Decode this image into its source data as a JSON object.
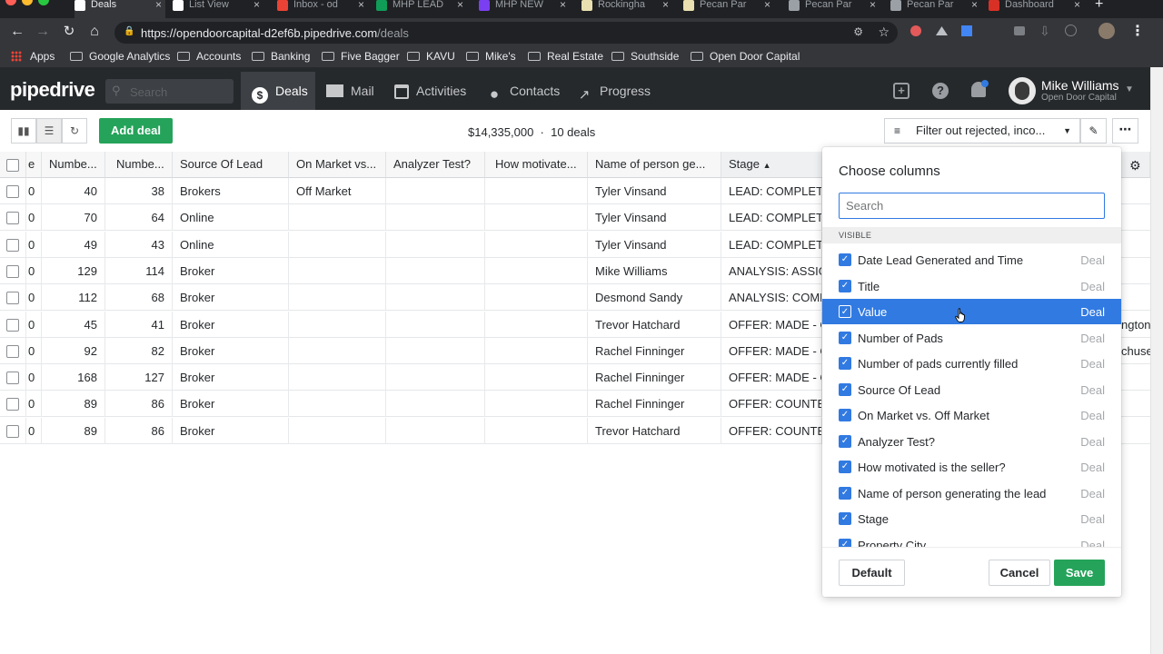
{
  "browser": {
    "tabs": [
      {
        "label": "Deals",
        "color": "#ffffff"
      },
      {
        "label": "List View",
        "color": "#ffffff"
      },
      {
        "label": "Inbox - od",
        "color": "#ea4335"
      },
      {
        "label": "MHP LEAD",
        "color": "#0f9d58"
      },
      {
        "label": "MHP NEW",
        "color": "#7b3ff2"
      },
      {
        "label": "Rockingha",
        "color": "#e9dfb0"
      },
      {
        "label": "Pecan Par",
        "color": "#e9dfb0"
      },
      {
        "label": "Pecan Par",
        "color": "#9aa0a6"
      },
      {
        "label": "Pecan Par",
        "color": "#9aa0a6"
      },
      {
        "label": "Dashboard",
        "color": "#d93025"
      }
    ],
    "url_host": "https://opendoorcapital-d2ef6b.pipedrive.com",
    "url_path": "/deals",
    "bookmarks": [
      "Apps",
      "Google Analytics",
      "Accounts",
      "Banking",
      "Five Bagger",
      "KAVU",
      "Mike's",
      "Real Estate",
      "Southside",
      "Open Door Capital"
    ]
  },
  "header": {
    "logo": "pipedrive",
    "search_placeholder": "Search",
    "nav": [
      "Deals",
      "Mail",
      "Activities",
      "Contacts",
      "Progress"
    ],
    "user_name": "Mike Williams",
    "user_org": "Open Door Capital"
  },
  "toolbar": {
    "add_deal": "Add deal",
    "total": "$14,335,000",
    "separator": "·",
    "count": "10 deals",
    "filter": "Filter out rejected, inco..."
  },
  "table": {
    "headers": [
      "e",
      "Numbe...",
      "Numbe...",
      "Source Of Lead",
      "On Market vs...",
      "Analyzer Test?",
      "How motivate...",
      "Name of person ge...",
      "Stage"
    ],
    "rows": [
      {
        "a": "0",
        "n1": "40",
        "n2": "38",
        "source": "Brokers",
        "market": "Off Market",
        "person": "Tyler Vinsand",
        "stage": "LEAD: COMPLETE-",
        "extra": ""
      },
      {
        "a": "0",
        "n1": "70",
        "n2": "64",
        "source": "Online",
        "market": "",
        "person": "Tyler Vinsand",
        "stage": "LEAD: COMPLETE-",
        "extra": ""
      },
      {
        "a": "0",
        "n1": "49",
        "n2": "43",
        "source": "Online",
        "market": "",
        "person": "Tyler Vinsand",
        "stage": "LEAD: COMPLETE-",
        "extra": ""
      },
      {
        "a": "0",
        "n1": "129",
        "n2": "114",
        "source": "Broker",
        "market": "",
        "person": "Mike Williams",
        "stage": "ANALYSIS: ASSIGN",
        "extra": ""
      },
      {
        "a": "0",
        "n1": "112",
        "n2": "68",
        "source": "Broker",
        "market": "",
        "person": "Desmond Sandy",
        "stage": "ANALYSIS: COMPL",
        "extra": ""
      },
      {
        "a": "0",
        "n1": "45",
        "n2": "41",
        "source": "Broker",
        "market": "",
        "person": "Trevor Hatchard",
        "stage": "OFFER: MADE - Co",
        "extra": "ngton"
      },
      {
        "a": "0",
        "n1": "92",
        "n2": "82",
        "source": "Broker",
        "market": "",
        "person": "Rachel Finninger",
        "stage": "OFFER: MADE - Co",
        "extra": "chuset"
      },
      {
        "a": "0",
        "n1": "168",
        "n2": "127",
        "source": "Broker",
        "market": "",
        "person": "Rachel Finninger",
        "stage": "OFFER: MADE - Co",
        "extra": ""
      },
      {
        "a": "0",
        "n1": "89",
        "n2": "86",
        "source": "Broker",
        "market": "",
        "person": "Rachel Finninger",
        "stage": "OFFER: COUNTER",
        "extra": ""
      },
      {
        "a": "0",
        "n1": "89",
        "n2": "86",
        "source": "Broker",
        "market": "",
        "person": "Trevor Hatchard",
        "stage": "OFFER: COUNTER",
        "extra": ""
      }
    ]
  },
  "modal": {
    "title": "Choose columns",
    "search_placeholder": "Search",
    "section": "VISIBLE",
    "columns": [
      {
        "name": "Date Lead Generated and Time",
        "type": "Deal",
        "checked": true
      },
      {
        "name": "Title",
        "type": "Deal",
        "checked": true
      },
      {
        "name": "Value",
        "type": "Deal",
        "checked": true,
        "highlighted": true
      },
      {
        "name": "Number of Pads",
        "type": "Deal",
        "checked": true
      },
      {
        "name": "Number of pads currently filled",
        "type": "Deal",
        "checked": true
      },
      {
        "name": "Source Of Lead",
        "type": "Deal",
        "checked": true
      },
      {
        "name": "On Market vs. Off Market",
        "type": "Deal",
        "checked": true
      },
      {
        "name": "Analyzer Test?",
        "type": "Deal",
        "checked": true
      },
      {
        "name": "How motivated is the seller?",
        "type": "Deal",
        "checked": true
      },
      {
        "name": "Name of person generating the lead",
        "type": "Deal",
        "checked": true
      },
      {
        "name": "Stage",
        "type": "Deal",
        "checked": true
      },
      {
        "name": "Property City",
        "type": "Deal",
        "checked": true
      }
    ],
    "default_btn": "Default",
    "cancel_btn": "Cancel",
    "save_btn": "Save"
  },
  "colors": {
    "brand_green": "#25a35a",
    "selection_blue": "#317ae2",
    "header_bg": "#26292c"
  }
}
